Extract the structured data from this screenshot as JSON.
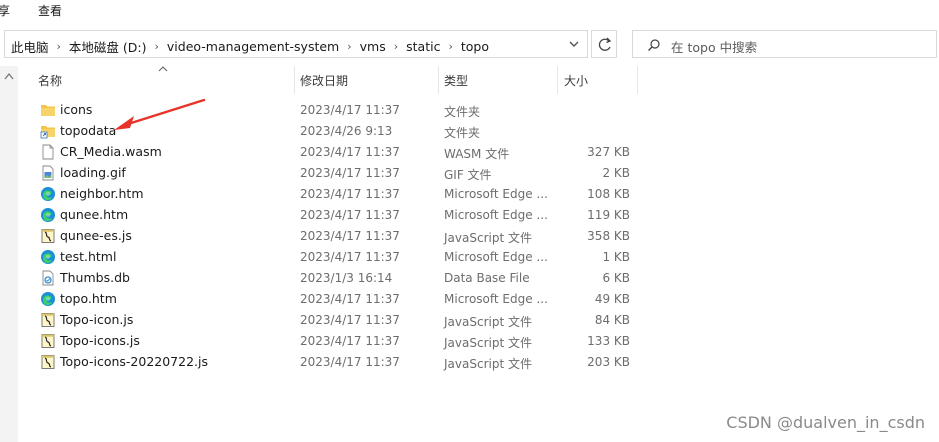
{
  "ribbon": {
    "tabs": [
      "享",
      "查看"
    ]
  },
  "address": {
    "crumbs": [
      "此电脑",
      "本地磁盘 (D:)",
      "video-management-system",
      "vms",
      "static",
      "topo"
    ]
  },
  "search": {
    "placeholder": "在 topo 中搜索"
  },
  "columns": {
    "name": "名称",
    "date": "修改日期",
    "type": "类型",
    "size": "大小"
  },
  "files": [
    {
      "name": "icons",
      "date": "2023/4/17 11:37",
      "type": "文件夹",
      "size": "",
      "icon": "folder-icon"
    },
    {
      "name": "topodata",
      "date": "2023/4/26 9:13",
      "type": "文件夹",
      "size": "",
      "icon": "folder-shortcut-icon"
    },
    {
      "name": "CR_Media.wasm",
      "date": "2023/4/17 11:37",
      "type": "WASM 文件",
      "size": "327 KB",
      "icon": "file-icon"
    },
    {
      "name": "loading.gif",
      "date": "2023/4/17 11:37",
      "type": "GIF 文件",
      "size": "2 KB",
      "icon": "image-file-icon"
    },
    {
      "name": "neighbor.htm",
      "date": "2023/4/17 11:37",
      "type": "Microsoft Edge ...",
      "size": "108 KB",
      "icon": "edge-icon"
    },
    {
      "name": "qunee.htm",
      "date": "2023/4/17 11:37",
      "type": "Microsoft Edge ...",
      "size": "119 KB",
      "icon": "edge-icon"
    },
    {
      "name": "qunee-es.js",
      "date": "2023/4/17 11:37",
      "type": "JavaScript 文件",
      "size": "358 KB",
      "icon": "script-icon"
    },
    {
      "name": "test.html",
      "date": "2023/4/17 11:37",
      "type": "Microsoft Edge ...",
      "size": "1 KB",
      "icon": "edge-icon"
    },
    {
      "name": "Thumbs.db",
      "date": "2023/1/3 16:14",
      "type": "Data Base File",
      "size": "6 KB",
      "icon": "db-file-icon"
    },
    {
      "name": "topo.htm",
      "date": "2023/4/17 11:37",
      "type": "Microsoft Edge ...",
      "size": "49 KB",
      "icon": "edge-icon"
    },
    {
      "name": "Topo-icon.js",
      "date": "2023/4/17 11:37",
      "type": "JavaScript 文件",
      "size": "84 KB",
      "icon": "script-icon"
    },
    {
      "name": "Topo-icons.js",
      "date": "2023/4/17 11:37",
      "type": "JavaScript 文件",
      "size": "133 KB",
      "icon": "script-icon"
    },
    {
      "name": "Topo-icons-20220722.js",
      "date": "2023/4/17 11:37",
      "type": "JavaScript 文件",
      "size": "203 KB",
      "icon": "script-icon"
    }
  ],
  "colors": {
    "accent": "#e8332a",
    "folder": "#f3c64b",
    "edge": "#1a8fd6"
  },
  "watermark": "CSDN @dualven_in_csdn"
}
